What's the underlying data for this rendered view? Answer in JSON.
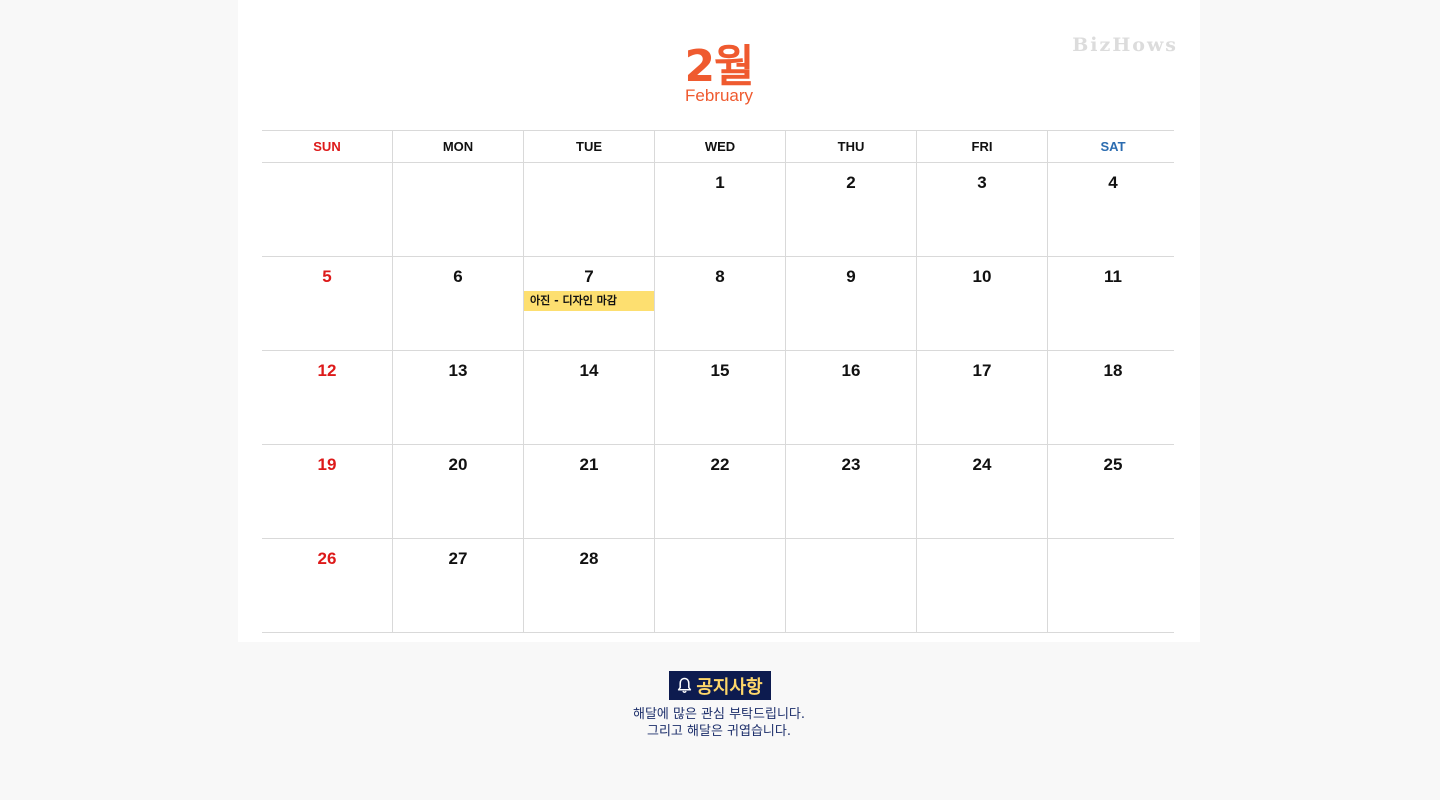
{
  "brand": "BizHows",
  "month": {
    "number_label": "2월",
    "english_label": "February"
  },
  "weekdays": [
    "SUN",
    "MON",
    "TUE",
    "WED",
    "THU",
    "FRI",
    "SAT"
  ],
  "weeks": [
    [
      "",
      "",
      "",
      "1",
      "2",
      "3",
      "4"
    ],
    [
      "5",
      "6",
      "7",
      "8",
      "9",
      "10",
      "11"
    ],
    [
      "12",
      "13",
      "14",
      "15",
      "16",
      "17",
      "18"
    ],
    [
      "19",
      "20",
      "21",
      "22",
      "23",
      "24",
      "25"
    ],
    [
      "26",
      "27",
      "28",
      "",
      "",
      "",
      ""
    ]
  ],
  "events": [
    {
      "day": "7",
      "label": "아진 - 디자인 마감",
      "color": "#fddf70"
    }
  ],
  "colors": {
    "accent": "#ef5a2f",
    "sunday": "#dd1a1a",
    "saturday": "#2b6cb0",
    "notice_bg": "#0d1b4f",
    "notice_text": "#ffd76a"
  },
  "notice": {
    "icon": "bell-icon",
    "title": "공지사항",
    "lines": [
      "해달에 많은 관심 부탁드립니다.",
      "그리고 해달은 귀엽습니다."
    ]
  }
}
